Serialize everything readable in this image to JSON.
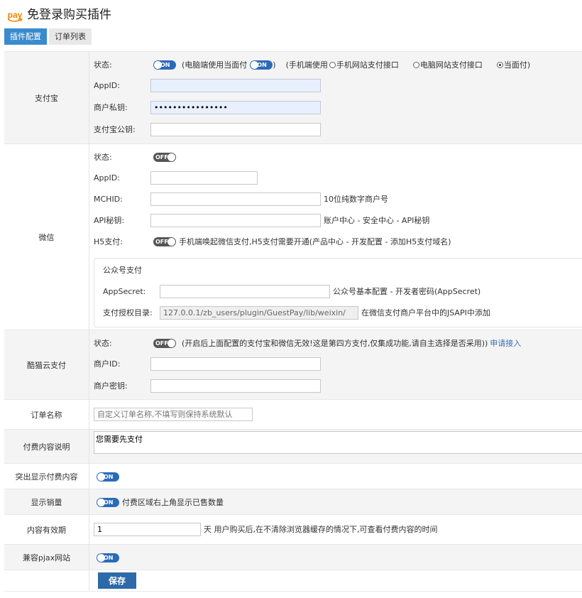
{
  "header": {
    "logo_text": "pay",
    "title": "免登录购买插件"
  },
  "tabs": [
    {
      "label": "插件配置"
    },
    {
      "label": "订单列表"
    }
  ],
  "alipay": {
    "section_label": "支付宝",
    "status_label": "状态:",
    "pc_note_open": "(电脑端使用当面付",
    "pc_note_close": ")",
    "mobile_note_open": "(手机端使用",
    "radio_mobile_web": "手机网站支付接口",
    "radio_pc_web": "电脑网站支付接口",
    "radio_face": "当面付)",
    "appid_label": "AppID:",
    "appid_value": "",
    "private_key_label": "商户私钥:",
    "private_key_value": "••••••••••••••••",
    "public_key_label": "支付宝公钥:",
    "public_key_value": ""
  },
  "toggles": {
    "on": "ON",
    "off": "OFF"
  },
  "wechat": {
    "section_label": "微信",
    "status_label": "状态:",
    "appid_label": "AppID:",
    "mchid_label": "MCHID:",
    "mchid_hint": "10位纯数字商户号",
    "apikey_label": "API秘钥:",
    "apikey_hint": "账户中心 - 安全中心 - API秘钥",
    "h5_label": "H5支付:",
    "h5_hint": "手机端唤起微信支付,H5支付需要开通(产品中心 - 开发配置 - 添加H5支付域名)",
    "mp_title": "公众号支付",
    "appsecret_label": "AppSecret:",
    "appsecret_hint": "公众号基本配置 - 开发者密码(AppSecret)",
    "auth_dir_label": "支付授权目录:",
    "auth_dir_value": "127.0.0.1/zb_users/plugin/GuestPay/lib/weixin/",
    "auth_dir_hint": "在微信支付商户平台中的JSAPI中添加"
  },
  "cat": {
    "section_label": "酷猫云支付",
    "status_label": "状态:",
    "status_hint": "(开启后上面配置的支付宝和微信无效!这是第四方支付,仅集成功能,请自主选择是否采用))",
    "apply_link": "申请接入",
    "merchant_id_label": "商户ID:",
    "merchant_key_label": "商户密钥:"
  },
  "order_name": {
    "label": "订单名称",
    "placeholder": "自定义订单名称,不填写则保持系统默认"
  },
  "paid_desc": {
    "label": "付费内容说明",
    "value": "您需要先支付"
  },
  "highlight": {
    "label": "突出显示付费内容"
  },
  "sales": {
    "label": "显示销量",
    "hint": "付费区域右上角显示已售数量"
  },
  "validity": {
    "label": "内容有效期",
    "value": "1",
    "hint": "天 用户购买后,在不清除浏览器缓存的情况下,可查看付费内容的时间"
  },
  "pjax": {
    "label": "兼容pjax网站"
  },
  "save_label": "保存"
}
